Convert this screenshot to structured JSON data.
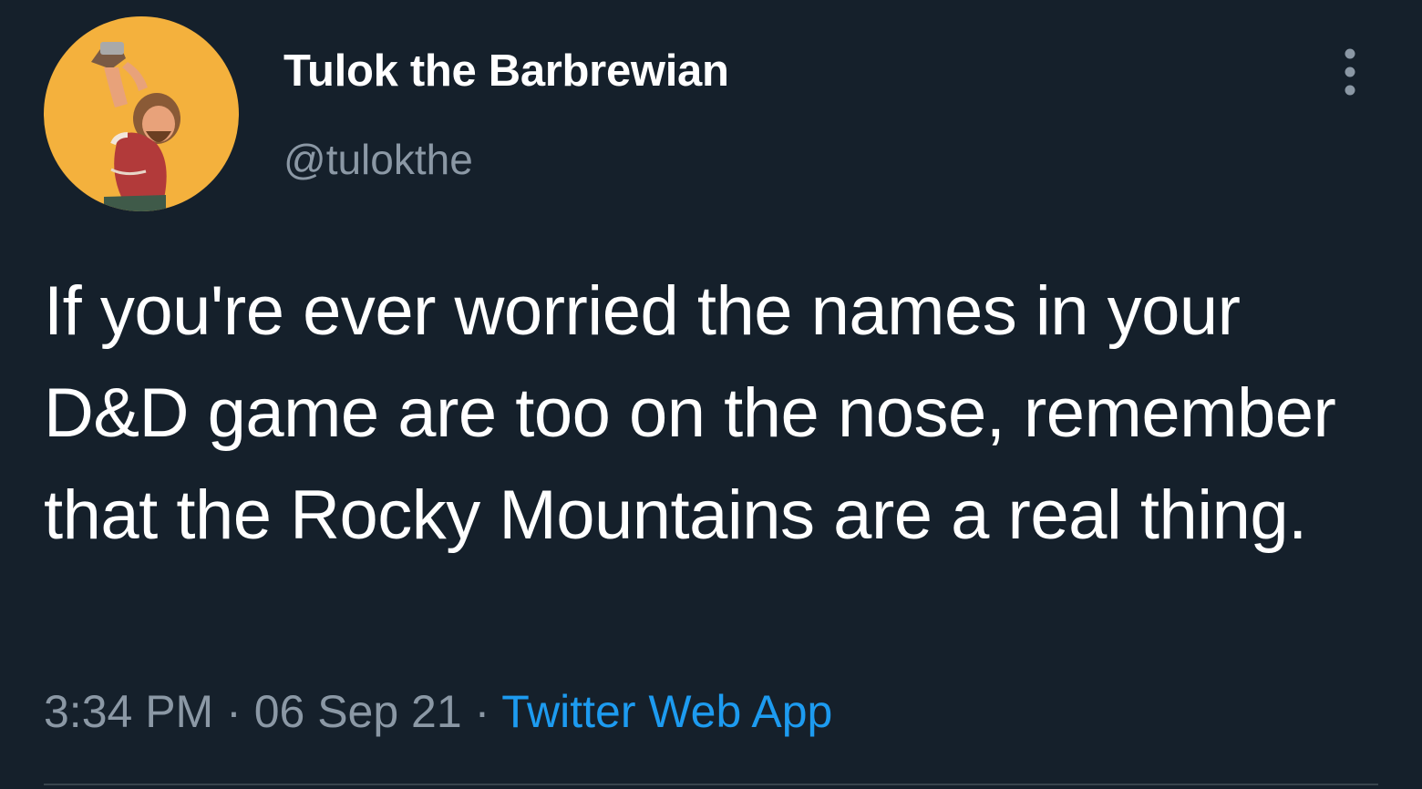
{
  "tweet": {
    "author": {
      "display_name": "Tulok the Barbrewian",
      "handle": "@tulokthe",
      "avatar_icon": "barbarian-avatar"
    },
    "more_icon": "more-vertical-icon",
    "text": "If you're ever worried the names in your D&D game are too on the nose, remember that the Rocky Mountains are a real thing.",
    "time": "3:34 PM",
    "separator": "·",
    "date": "06 Sep 21",
    "source": "Twitter Web App"
  },
  "colors": {
    "background": "#15202b",
    "primary_text": "#ffffff",
    "secondary_text": "#8b98a5",
    "link": "#1d9bf0",
    "avatar_background": "#f4b13d"
  }
}
